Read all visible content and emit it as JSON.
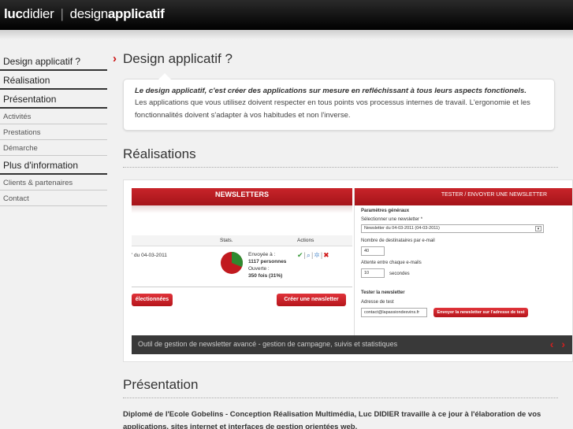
{
  "header": {
    "brand_bold": "luc",
    "brand_light": "didier",
    "separator": "|",
    "tagline_light": "design",
    "tagline_bold": "applicatif"
  },
  "sidebar": {
    "items": [
      {
        "label": "Design applicatif ?",
        "level": "main"
      },
      {
        "label": "Réalisation",
        "level": "main"
      },
      {
        "label": "Présentation",
        "level": "main"
      },
      {
        "label": "Activités",
        "level": "sub"
      },
      {
        "label": "Prestations",
        "level": "sub"
      },
      {
        "label": "Démarche",
        "level": "sub"
      },
      {
        "label": "Plus d'information",
        "level": "main"
      },
      {
        "label": "Clients & partenaires",
        "level": "sub"
      },
      {
        "label": "Contact",
        "level": "sub"
      }
    ]
  },
  "main": {
    "title": "Design applicatif ?",
    "intro_lead": "Le design applicatif, c'est créer des applications sur mesure en refléchissant à tous leurs aspects fonctionels.",
    "intro_body": "Les applications que vous utilisez doivent respecter en tous points vos processus internes de travail. L'ergonomie et les fonctionnalités doivent s'adapter à vos habitudes et non l'inverse.",
    "realisations_title": "Réalisations",
    "presentation_title": "Présentation",
    "presentation_text": "Diplomé de l'Ecole Gobelins - Conception Réalisation Multimédia, Luc DIDIER travaille à ce jour à l'élaboration de vos applications, sites internet et interfaces de gestion orientées web."
  },
  "screenshot": {
    "newsletters_bar": "NEWSLETTERS",
    "col_stats": "Stats.",
    "col_actions": "Actions",
    "row_date": "' du 04-03-2011",
    "sent_label": "Envoyée à :",
    "sent_value": "1117 personnes",
    "opened_label": "Ouverte :",
    "opened_value": "350 fois (31%)",
    "opened_fraction": 0.31,
    "btn_selected": "électionnées",
    "btn_create": "Créer une newsletter",
    "right_bar": "TESTER / ENVOYER UNE NEWSLETTER",
    "params_title": "Paramètres généraux",
    "select_label": "Sélectionner une newsletter *",
    "select_value": "Newsletter du 04-03-2011 (04-03-2011)",
    "recipients_label": "Nombre de destinataires par e-mail",
    "recipients_value": "40",
    "wait_label": "Attente entre chaque e-mails",
    "wait_value": "10",
    "wait_unit": "secondes",
    "test_title": "Tester la newsletter",
    "test_address_label": "Adresse de test",
    "test_address_value": "contact@lapassiondesvins.fr",
    "btn_send_test": "Envoyer la newsletter sur l'adresse de test",
    "caption": "Outil de gestion de newsletter avancé - gestion de campagne, suivis et statistiques",
    "nav_arrows": "‹ ›"
  },
  "colors": {
    "accent_red": "#cc1111",
    "header_bg": "#111111",
    "page_bg": "#f1f1f1"
  }
}
